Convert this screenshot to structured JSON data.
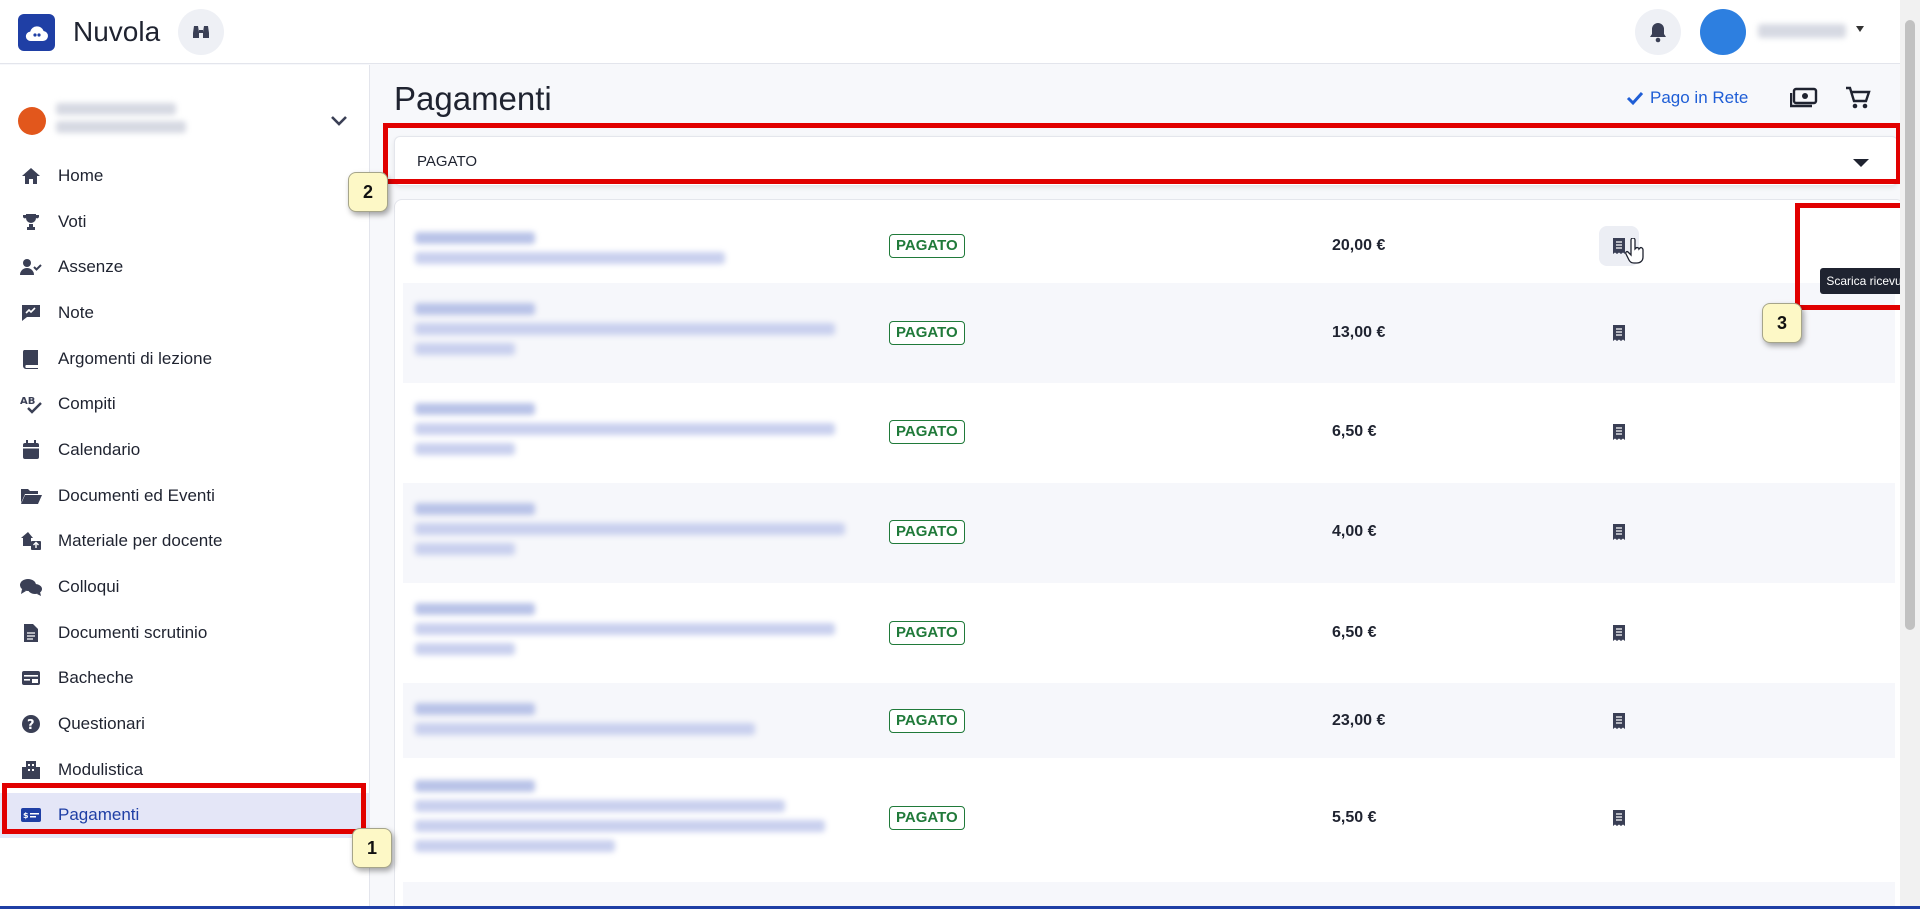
{
  "app": {
    "title": "Nuvola"
  },
  "sidebar": {
    "items": [
      {
        "label": "Home",
        "icon": "home-icon"
      },
      {
        "label": "Voti",
        "icon": "trophy-icon"
      },
      {
        "label": "Assenze",
        "icon": "user-check-icon"
      },
      {
        "label": "Note",
        "icon": "note-icon"
      },
      {
        "label": "Argomenti di lezione",
        "icon": "book-icon"
      },
      {
        "label": "Compiti",
        "icon": "spellcheck-icon"
      },
      {
        "label": "Calendario",
        "icon": "calendar-icon"
      },
      {
        "label": "Documenti ed Eventi",
        "icon": "folder-open-icon"
      },
      {
        "label": "Materiale per docente",
        "icon": "house-upload-icon"
      },
      {
        "label": "Colloqui",
        "icon": "chat-icon"
      },
      {
        "label": "Documenti scrutinio",
        "icon": "document-icon"
      },
      {
        "label": "Bacheche",
        "icon": "board-icon"
      },
      {
        "label": "Questionari",
        "icon": "question-icon"
      },
      {
        "label": "Modulistica",
        "icon": "building-icon"
      },
      {
        "label": "Pagamenti",
        "icon": "payment-card-icon",
        "active": true
      }
    ]
  },
  "main": {
    "title": "Pagamenti",
    "pago_link": "Pago in Rete",
    "filter_value": "PAGATO",
    "rows": [
      {
        "status": "PAGATO",
        "amount": "20,00 €"
      },
      {
        "status": "PAGATO",
        "amount": "13,00 €"
      },
      {
        "status": "PAGATO",
        "amount": "6,50 €"
      },
      {
        "status": "PAGATO",
        "amount": "4,00 €"
      },
      {
        "status": "PAGATO",
        "amount": "6,50 €"
      },
      {
        "status": "PAGATO",
        "amount": "23,00 €"
      },
      {
        "status": "PAGATO",
        "amount": "5,50 €"
      }
    ],
    "tooltip": "Scarica ricevuta"
  },
  "annotations": {
    "n1": "1",
    "n2": "2",
    "n3": "3"
  },
  "colors": {
    "brand": "#1f3fa5",
    "link": "#1f5ed6",
    "paid": "#207a3a",
    "highlight": "#e10000"
  }
}
